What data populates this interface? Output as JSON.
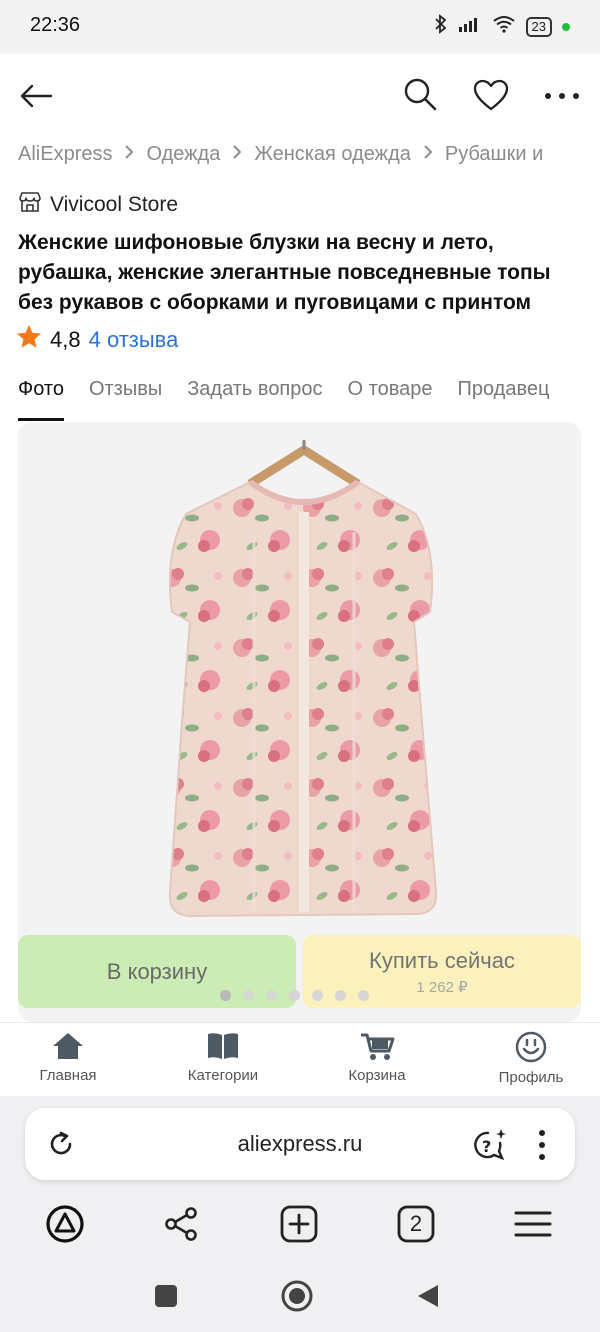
{
  "status_bar": {
    "time": "22:36",
    "battery": "23"
  },
  "breadcrumb": [
    "AliExpress",
    "Одежда",
    "Женская одежда",
    "Рубашки и"
  ],
  "store": {
    "name": "Vivicool Store"
  },
  "product": {
    "title": "Женские шифоновые блузки на весну и лето, рубашка, женские элегантные повседневные топы без рукавов с оборками и пуговицами с принтом",
    "rating": "4,8",
    "reviews_label": "4 отзыва"
  },
  "tabs": [
    "Фото",
    "Отзывы",
    "Задать вопрос",
    "О товаре",
    "Продавец"
  ],
  "actions": {
    "cart_label": "В корзину",
    "buy_label": "Купить сейчас",
    "buy_price": "1 262 ₽"
  },
  "gallery": {
    "slide_count": 7,
    "active_slide": 1
  },
  "bottom_nav": [
    "Главная",
    "Категории",
    "Корзина",
    "Профиль"
  ],
  "browser": {
    "url": "aliexpress.ru",
    "tab_count": "2"
  },
  "colors": {
    "accent_link": "#2e6fdb",
    "star": "#f27a1a",
    "cart_button": "#c9ecb0",
    "buy_button": "#fbf1b8"
  }
}
